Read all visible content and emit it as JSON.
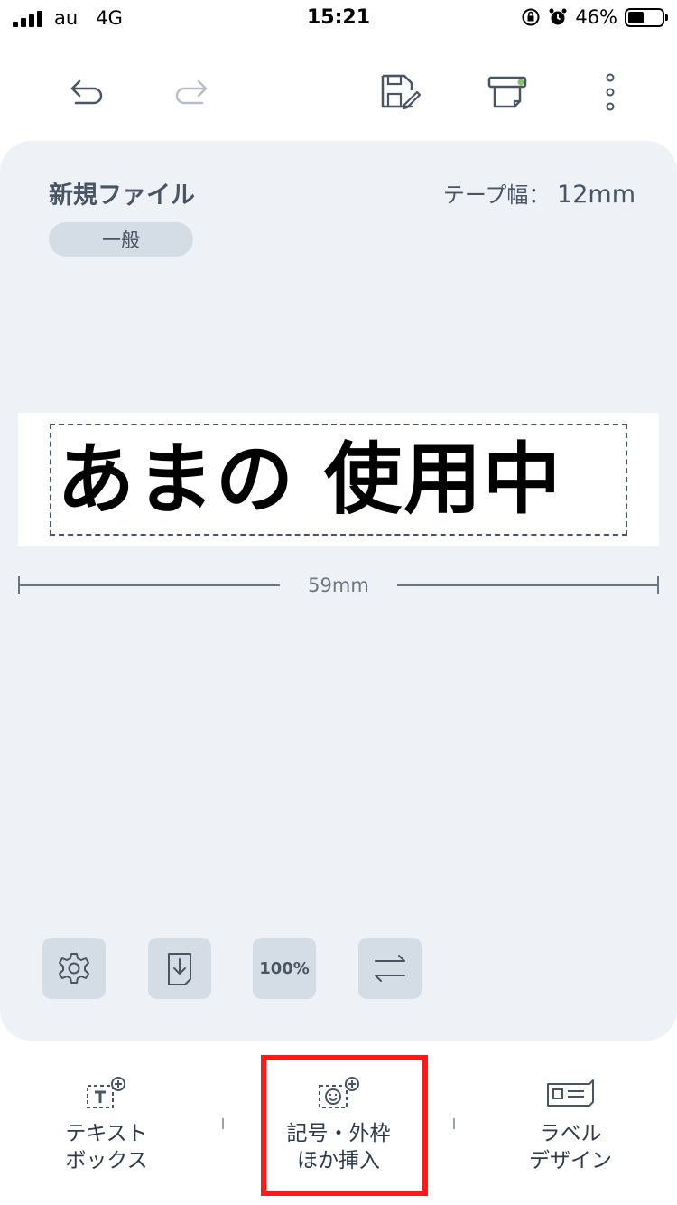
{
  "status_bar": {
    "carrier": "au",
    "network": "4G",
    "time": "15:21",
    "battery_percent": "46%",
    "battery_level": 0.46,
    "icons": [
      "signal-icon",
      "orientation-lock-icon",
      "alarm-icon",
      "battery-icon"
    ]
  },
  "toolbar": {
    "icons": [
      "undo-icon",
      "redo-icon",
      "save-icon",
      "print-icon",
      "more-icon"
    ]
  },
  "document": {
    "file_name": "新規ファイル",
    "category": "一般",
    "tape_width_label": "テープ幅：",
    "tape_width_value": "12mm",
    "label_text": "あまの 使用中",
    "length": "59mm"
  },
  "tools": {
    "zoom": "100%",
    "icons": [
      "settings-icon",
      "download-icon",
      "zoom-icon",
      "swap-direction-icon"
    ]
  },
  "bottom_bar": {
    "items": [
      {
        "label": "テキスト\nボックス",
        "icon": "add-textbox-icon"
      },
      {
        "label": "記号・外枠\nほか挿入",
        "icon": "add-symbol-icon"
      },
      {
        "label": "ラベル\nデザイン",
        "icon": "label-design-icon"
      }
    ],
    "highlight_color": "#ff1a1a"
  },
  "colors": {
    "card_background": "#eef2f7",
    "text_gray": "#4a5563",
    "pill_background": "#d4dce5"
  }
}
